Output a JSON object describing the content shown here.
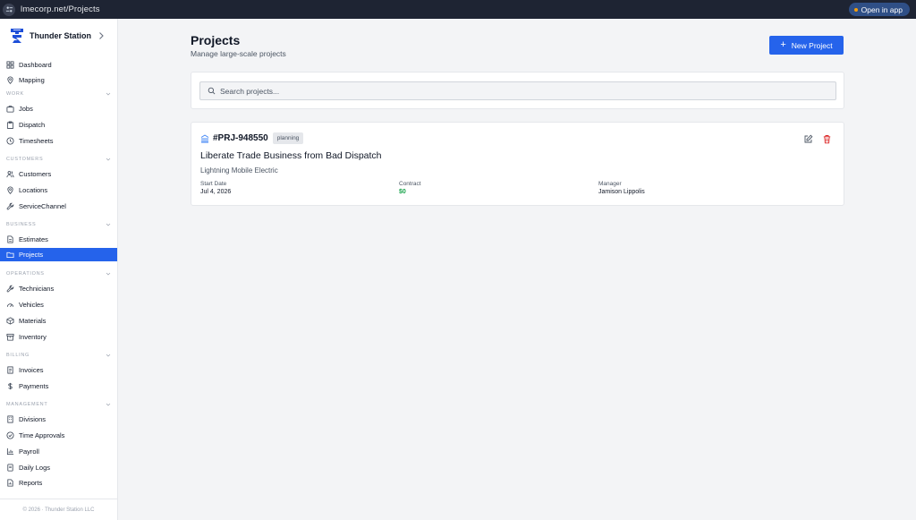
{
  "browser": {
    "url": "lmecorp.net/Projects",
    "open_in_app": "Open in app"
  },
  "sidebar": {
    "brand": "Thunder Station",
    "items": [
      {
        "label": "Dashboard"
      },
      {
        "label": "Mapping"
      },
      {
        "label": "Jobs"
      },
      {
        "label": "Dispatch"
      },
      {
        "label": "Timesheets"
      },
      {
        "label": "Customers"
      },
      {
        "label": "Locations"
      },
      {
        "label": "ServiceChannel"
      },
      {
        "label": "Estimates"
      },
      {
        "label": "Projects"
      },
      {
        "label": "Technicians"
      },
      {
        "label": "Vehicles"
      },
      {
        "label": "Materials"
      },
      {
        "label": "Inventory"
      },
      {
        "label": "Invoices"
      },
      {
        "label": "Payments"
      },
      {
        "label": "Divisions"
      },
      {
        "label": "Time Approvals"
      },
      {
        "label": "Payroll"
      },
      {
        "label": "Daily Logs"
      },
      {
        "label": "Reports"
      }
    ],
    "sections": {
      "work": "WORK",
      "customers": "CUSTOMERS",
      "business": "BUSINESS",
      "operations": "OPERATIONS",
      "billing": "BILLING",
      "management": "MANAGEMENT"
    },
    "active": "Projects",
    "footer": "© 2026 · Thunder Station LLC"
  },
  "main": {
    "title": "Projects",
    "subtitle": "Manage large-scale projects",
    "new_button": "New Project",
    "search_placeholder": "Search projects...",
    "projects": [
      {
        "id": "#PRJ-948550",
        "status": "planning",
        "name": "Liberate Trade Business from Bad Dispatch",
        "client": "Lightning Mobile Electric",
        "start_date_label": "Start Date",
        "start_date": "Jul 4, 2026",
        "contract_label": "Contract",
        "contract": "$0",
        "manager_label": "Manager",
        "manager": "Jamison Lippolis"
      }
    ]
  },
  "colors": {
    "accent": "#2563eb",
    "topbar": "#1e2433",
    "success": "#16a34a",
    "danger": "#dc2626"
  }
}
